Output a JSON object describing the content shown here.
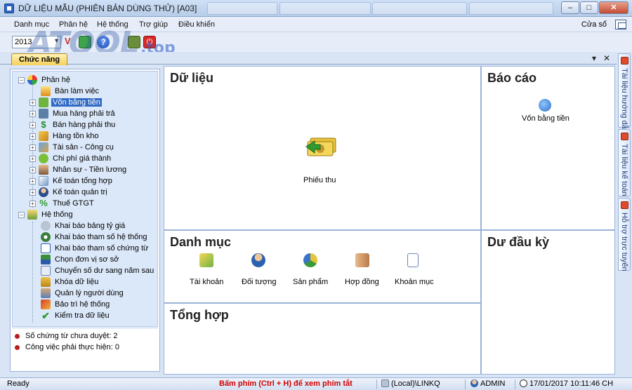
{
  "window": {
    "title": "DỮ LIỆU MẪU (PHIÊN BẢN DÙNG THỬ) [A03]",
    "minimize": "–",
    "maximize": "□",
    "close": "✕"
  },
  "menu": {
    "items": [
      "Danh mục",
      "Phân hệ",
      "Hệ thống",
      "Trợ giúp",
      "Điều khiển"
    ],
    "right": "Cửa sổ"
  },
  "toolbar": {
    "year": "2013",
    "help_glyph": "?",
    "v_glyph": "V"
  },
  "watermark": {
    "text": "ATOOL",
    "suffix": ".top"
  },
  "function_tab": {
    "label": "Chức năng",
    "pin": "▾",
    "close": "✕"
  },
  "tree": {
    "groups": [
      {
        "label": "Phân hệ",
        "items": [
          "Bàn làm việc",
          "Vốn bằng tiền",
          "Mua hàng phải trả",
          "Bán hàng phải thu",
          "Hàng tồn kho",
          "Tài sản - Công cụ",
          "Chi phí giá thành",
          "Nhân sự - Tiền lương",
          "Kế toán tổng hợp",
          "Kế toán quản trị",
          "Thuế GTGT"
        ]
      },
      {
        "label": "Hệ thống",
        "items": [
          "Khai báo bảng tỷ giá",
          "Khai báo tham số hệ thống",
          "Khai báo tham số chứng từ",
          "Chọn đơn vị sơ sở",
          "Chuyển số dư sang năm sau",
          "Khóa dữ liệu",
          "Quản lý người dùng",
          "Bảo trì hệ thống",
          "Kiểm tra dữ liệu"
        ]
      }
    ],
    "selected": "Vốn bằng tiền"
  },
  "info": {
    "pending_vouchers": "Số chứng từ chưa duyệt: 2",
    "pending_tasks": "Công việc phải thực hiện: 0"
  },
  "panels": {
    "data": {
      "title": "Dữ liệu",
      "items": [
        "Phiếu thu"
      ]
    },
    "reports": {
      "title": "Báo cáo",
      "items": [
        "Vốn bằng tiền"
      ]
    },
    "catalog": {
      "title": "Danh mục",
      "items": [
        "Tài khoản",
        "Đối tượng",
        "Sản phẩm",
        "Hợp đồng",
        "Khoản mục"
      ]
    },
    "opening": {
      "title": "Dư đầu kỳ"
    },
    "summary": {
      "title": "Tổng hợp"
    }
  },
  "side_tabs": [
    "Tài liệu hướng dẫn",
    "Tài liệu kế toán",
    "Hỗ trợ trực tuyến"
  ],
  "status": {
    "left": "Ready",
    "hint": "Bấm phím (Ctrl + H) để xem phím tắt",
    "server": "(Local)\\LINKQ",
    "user": "ADMIN",
    "datetime": "17/01/2017 10:11:46 CH"
  },
  "colors": {
    "selection": "#316ac5",
    "hint": "#d40000",
    "tree_bg": "#dbe8f9",
    "accent_tab": "#f5cf5a"
  }
}
